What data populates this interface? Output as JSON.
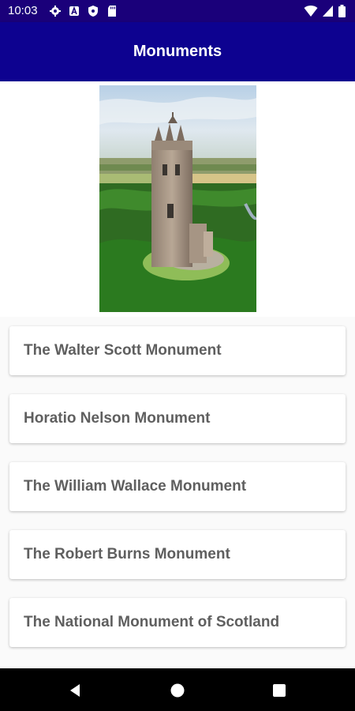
{
  "status_bar": {
    "time": "10:03",
    "icons": [
      "gear-icon",
      "a-notification-icon",
      "shield-icon",
      "sd-card-icon"
    ],
    "right_icons": [
      "wifi-icon",
      "signal-icon",
      "battery-icon"
    ]
  },
  "app_bar": {
    "title": "Monuments"
  },
  "hero": {
    "image": "wallace-monument-tower-photo"
  },
  "monuments": [
    {
      "label": "The Walter Scott Monument"
    },
    {
      "label": "Horatio Nelson Monument"
    },
    {
      "label": "The William Wallace Monument"
    },
    {
      "label": "The Robert Burns Monument"
    },
    {
      "label": "The National Monument of Scotland"
    }
  ],
  "nav": {
    "icons": [
      "back-icon",
      "home-icon",
      "recents-icon"
    ]
  },
  "colors": {
    "status_bar": "#1a007a",
    "app_bar": "#0d0290",
    "card_text": "#5f5f5f",
    "nav_bar": "#000000"
  }
}
